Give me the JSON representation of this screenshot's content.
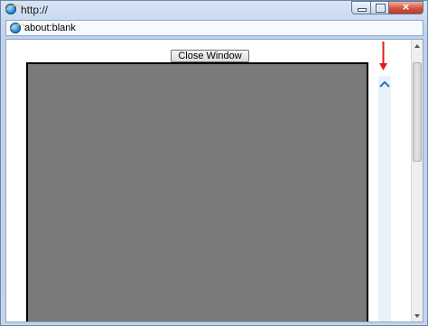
{
  "window": {
    "title": "http://",
    "address": "about:blank"
  },
  "content": {
    "close_button_label": "Close Window"
  },
  "colors": {
    "gray_box": "#7a7a7a",
    "arrow": "#e21b1b",
    "inner_caret": "#2e6fb7"
  },
  "icons": {
    "browser": "ie-icon",
    "minimize": "minimize-icon",
    "maximize": "maximize-icon",
    "close": "close-icon",
    "arrow": "red-down-arrow-icon",
    "caret": "chevron-up-icon"
  }
}
